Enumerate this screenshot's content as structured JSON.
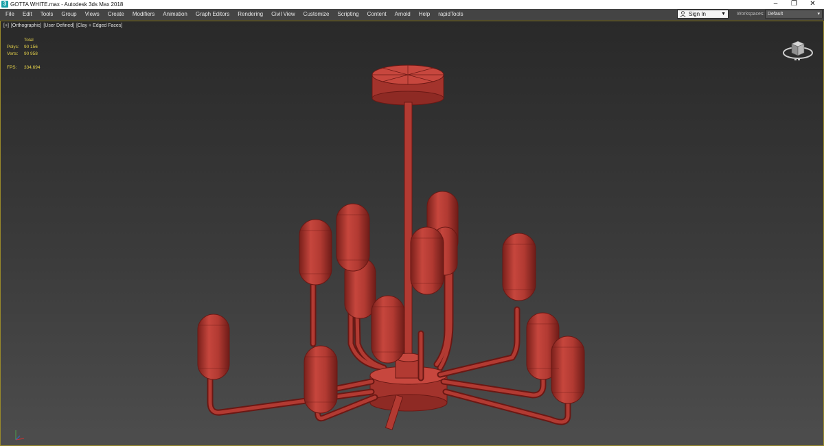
{
  "window": {
    "app_icon": "3",
    "title": "GOTTA WHITE.max - Autodesk 3ds Max 2018",
    "controls": {
      "minimize": "–",
      "restore": "❐",
      "close": "✕"
    }
  },
  "menu": {
    "items": [
      "File",
      "Edit",
      "Tools",
      "Group",
      "Views",
      "Create",
      "Modifiers",
      "Animation",
      "Graph Editors",
      "Rendering",
      "Civil View",
      "Customize",
      "Scripting",
      "Content",
      "Arnold",
      "Help",
      "rapidTools"
    ],
    "sign_in": {
      "label": "Sign In",
      "icon": "user-icon"
    },
    "workspaces": {
      "label": "Workspaces:",
      "value": "Default"
    }
  },
  "viewport": {
    "labels": {
      "plus": "[+]",
      "view": "[Orthographic]",
      "mode": "[User Defined]",
      "shading": "[Clay + Edged Faces]"
    },
    "stats": {
      "total_label": "Total",
      "polys_label": "Polys:",
      "polys_value": "90 156",
      "verts_label": "Verts:",
      "verts_value": "90 958",
      "fps_label": "FPS:",
      "fps_value": "334,694"
    },
    "model_color": "#b23a32",
    "edge_color": "#6a1814",
    "border_color": "#9a8a2a"
  }
}
